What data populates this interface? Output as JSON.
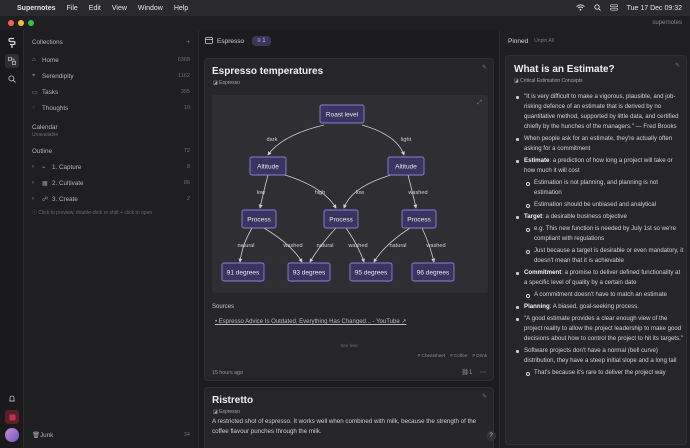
{
  "menubar": {
    "app": "Supernotes",
    "items": [
      "File",
      "Edit",
      "View",
      "Window",
      "Help"
    ],
    "clock": "Tue 17 Dec  09:32"
  },
  "window": {
    "brand": "supernotes"
  },
  "sidebar": {
    "collections_label": "Collections",
    "items": [
      {
        "label": "Home",
        "count": "6368",
        "icon": "home-icon"
      },
      {
        "label": "Serendipity",
        "count": "1162",
        "icon": "telescope-icon"
      },
      {
        "label": "Tasks",
        "count": "395",
        "icon": "inbox-icon"
      },
      {
        "label": "Thoughts",
        "count": "10",
        "icon": "bubble-icon"
      }
    ],
    "calendar_label": "Calendar",
    "calendar_sub": "Unavailable",
    "outline_label": "Outline",
    "outline_count": "72",
    "outline_items": [
      {
        "label": "1. Capture",
        "count": "8"
      },
      {
        "label": "2. Cultivate",
        "count": "86"
      },
      {
        "label": "3. Create",
        "count": "2"
      }
    ],
    "hint": "Click to preview, double-click or shift + click to open",
    "junk_label": "Junk",
    "junk_count": "34"
  },
  "toolbar": {
    "collection": "Espresso",
    "filter_count": "1"
  },
  "card1": {
    "title": "Espresso temperatures",
    "tag": "Espresso",
    "diagram": {
      "root": "Roast level",
      "edge_dark": "dark",
      "edge_light": "light",
      "alt_left": "Altitude",
      "alt_right": "Altitude",
      "e_low1": "low",
      "e_high": "high",
      "e_low2": "low",
      "e_washed1": "washed",
      "proc1": "Process",
      "proc2": "Process",
      "proc3": "Process",
      "e_natural1": "natural",
      "e_washed2": "washed",
      "e_natural2": "natural",
      "e_washed3": "washed",
      "e_natural3": "natural",
      "e_washed4": "washed",
      "t1": "91 degrees",
      "t2": "93 degrees",
      "t3": "95 degrees",
      "t4": "96 degrees"
    },
    "sources_label": "Sources",
    "source_item": "Espresso Advice Is Outdated, Everything Has Changed... - YouTube ↗",
    "see_less": "See less",
    "tags": [
      "Cheatsheet",
      "Coffee",
      "Drink"
    ],
    "time": "15 hours ago",
    "link_count": "1"
  },
  "card2": {
    "title": "Ristretto",
    "tag": "Espresso",
    "body": "A restricted shot of espresso. It works well when combined with milk, because the strength of the coffee flavour punches through the milk."
  },
  "pinned": {
    "label": "Pinned",
    "unpin_all": "Unpin All",
    "title": "What is an Estimate?",
    "tag": "Critical Estimation Concepts",
    "bullets": [
      {
        "level": 1,
        "bold": "",
        "text": "\"It is very difficult to make a vigorous, plausible, and job-risking defence of an estimate that is derived by no quantitative method, supported by little data, and certified chiefly by the hunches of the managers.\" — Fred Brooks"
      },
      {
        "level": 1,
        "bold": "",
        "text": "When people ask for an estimate, they're actually often asking for a commitment"
      },
      {
        "level": 1,
        "bold": "Estimate",
        "text": ": a prediction of how long a project will take or how much it will cost"
      },
      {
        "level": 2,
        "bold": "",
        "text": "Estimation is not planning, and planning is not estimation"
      },
      {
        "level": 2,
        "bold": "",
        "text": "Estimation should be unbiased and analytical"
      },
      {
        "level": 1,
        "bold": "Target",
        "text": ": a desirable business objective"
      },
      {
        "level": 2,
        "bold": "",
        "text": "e.g. This new function is needed by July 1st so we're compliant with regulations"
      },
      {
        "level": 2,
        "bold": "",
        "text": "Just because a target is desirable or even mandatory, it doesn't mean that it is achievable"
      },
      {
        "level": 1,
        "bold": "Commitment",
        "text": ": a promise to deliver defined functionality at a specific level of quality by a certain date"
      },
      {
        "level": 2,
        "bold": "",
        "text": "A commitment doesn't have to match an estimate"
      },
      {
        "level": 1,
        "bold": "Planning",
        "text": ": A biased, goal-seeking process."
      },
      {
        "level": 1,
        "bold": "",
        "text": "\"A good estimate provides a clear enough view of the project reality to allow the project leadership to make good decisions about how to control the project to hit its targets.\""
      },
      {
        "level": 1,
        "bold": "",
        "text": "Software projects don't have a normal (bell curve) distribution, they have a steep initial slope and a long tail"
      },
      {
        "level": 2,
        "bold": "",
        "text": "That's because it's rare to deliver the project way"
      }
    ]
  },
  "colors": {
    "accent": "#7b6cf0",
    "node_fill": "#3a3560",
    "node_stroke": "#8a80d8"
  }
}
